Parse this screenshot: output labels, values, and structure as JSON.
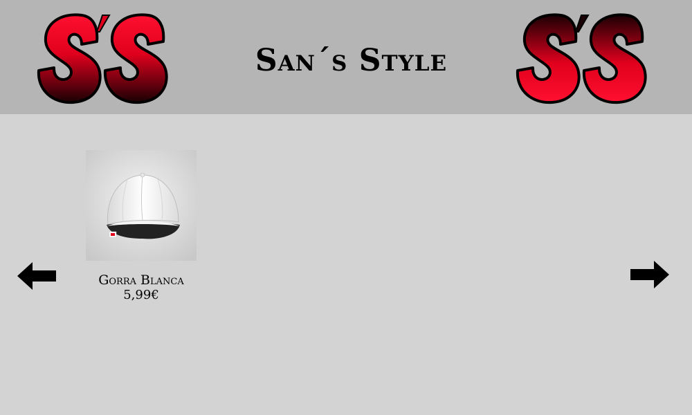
{
  "header": {
    "title": "San´s Style",
    "logo_text": "S´S",
    "logo_colors": {
      "red": "#ff0a2a",
      "black": "#000000"
    }
  },
  "carousel": {
    "prev_icon": "arrow-left-icon",
    "next_icon": "arrow-right-icon",
    "products": [
      {
        "name": "Gorra Blanca",
        "price": "5,99€",
        "image_icon": "white-cap-image"
      }
    ]
  },
  "colors": {
    "header_bg": "#b5b5b5",
    "page_bg": "#d3d3d3"
  }
}
